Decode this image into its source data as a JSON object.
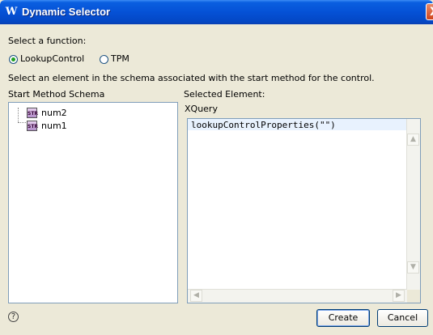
{
  "window": {
    "title": "Dynamic Selector",
    "app_icon": "W",
    "close_glyph": "X"
  },
  "function_section": {
    "label": "Select a function:",
    "options": [
      {
        "label": "LookupControl",
        "selected": true
      },
      {
        "label": "TPM",
        "selected": false
      }
    ]
  },
  "instruction": "Select an element in the schema associated with the start method for the control.",
  "schema_panel": {
    "label": "Start Method Schema",
    "items": [
      {
        "label": "num2",
        "icon": "string-type-icon",
        "icon_text": "STR"
      },
      {
        "label": "num1",
        "icon": "string-type-icon",
        "icon_text": "STR"
      }
    ]
  },
  "selected_panel": {
    "label": "Selected Element:",
    "sublabel": "XQuery",
    "code": "lookupControlProperties(\"\")"
  },
  "buttons": {
    "create": "Create",
    "cancel": "Cancel",
    "help_glyph": "?"
  },
  "colors": {
    "titlebar": "#0551d6",
    "dialog_bg": "#ece9d8",
    "code_highlight": "#e8f2fe",
    "radio_selected": "#21a121"
  }
}
